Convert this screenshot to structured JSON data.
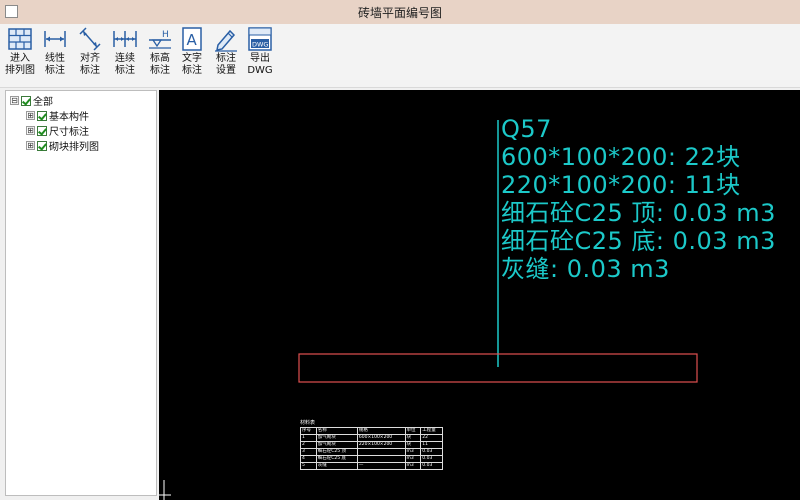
{
  "window": {
    "title": "砖墙平面编号图"
  },
  "toolbar": {
    "items": [
      {
        "label": "进入\n排列图"
      },
      {
        "label": "线性\n标注"
      },
      {
        "label": "对齐\n标注"
      },
      {
        "label": "连续\n标注"
      },
      {
        "label": "标高\n标注"
      },
      {
        "label": "文字\n标注"
      },
      {
        "label": "标注\n设置"
      },
      {
        "label": "导出\nDWG"
      }
    ]
  },
  "tree": {
    "root": {
      "label": "全部",
      "expander": "⊟",
      "checked": true
    },
    "children": [
      {
        "label": "基本构件",
        "expander": "⊞",
        "checked": true
      },
      {
        "label": "尺寸标注",
        "expander": "⊞",
        "checked": true
      },
      {
        "label": "砌块排列图",
        "expander": "⊞",
        "checked": true
      }
    ]
  },
  "canvas": {
    "annotation_lines": [
      "Q57",
      "600*100*200: 22块",
      "220*100*200: 11块",
      "细石砼C25  顶: 0.03 m3",
      "细石砼C25  底: 0.03 m3",
      "灰缝: 0.03 m3"
    ],
    "colors": {
      "annotation": "#1cc9c9",
      "wall_outline": "#e05050",
      "background": "#000000"
    },
    "table": {
      "caption": "材料表",
      "header": [
        "序号",
        "名称",
        "规格",
        "单位",
        "工程量"
      ],
      "rows": [
        [
          "1",
          "加气砌块",
          "600×100×200",
          "块",
          "22"
        ],
        [
          "2",
          "加气砌块",
          "220×100×200",
          "块",
          "11"
        ],
        [
          "3",
          "细石砼C25 顶",
          "",
          "m3",
          "0.03"
        ],
        [
          "4",
          "细石砼C25 底",
          "",
          "m3",
          "0.03"
        ],
        [
          "5",
          "灰缝",
          "—",
          "m3",
          "0.03"
        ]
      ]
    }
  }
}
